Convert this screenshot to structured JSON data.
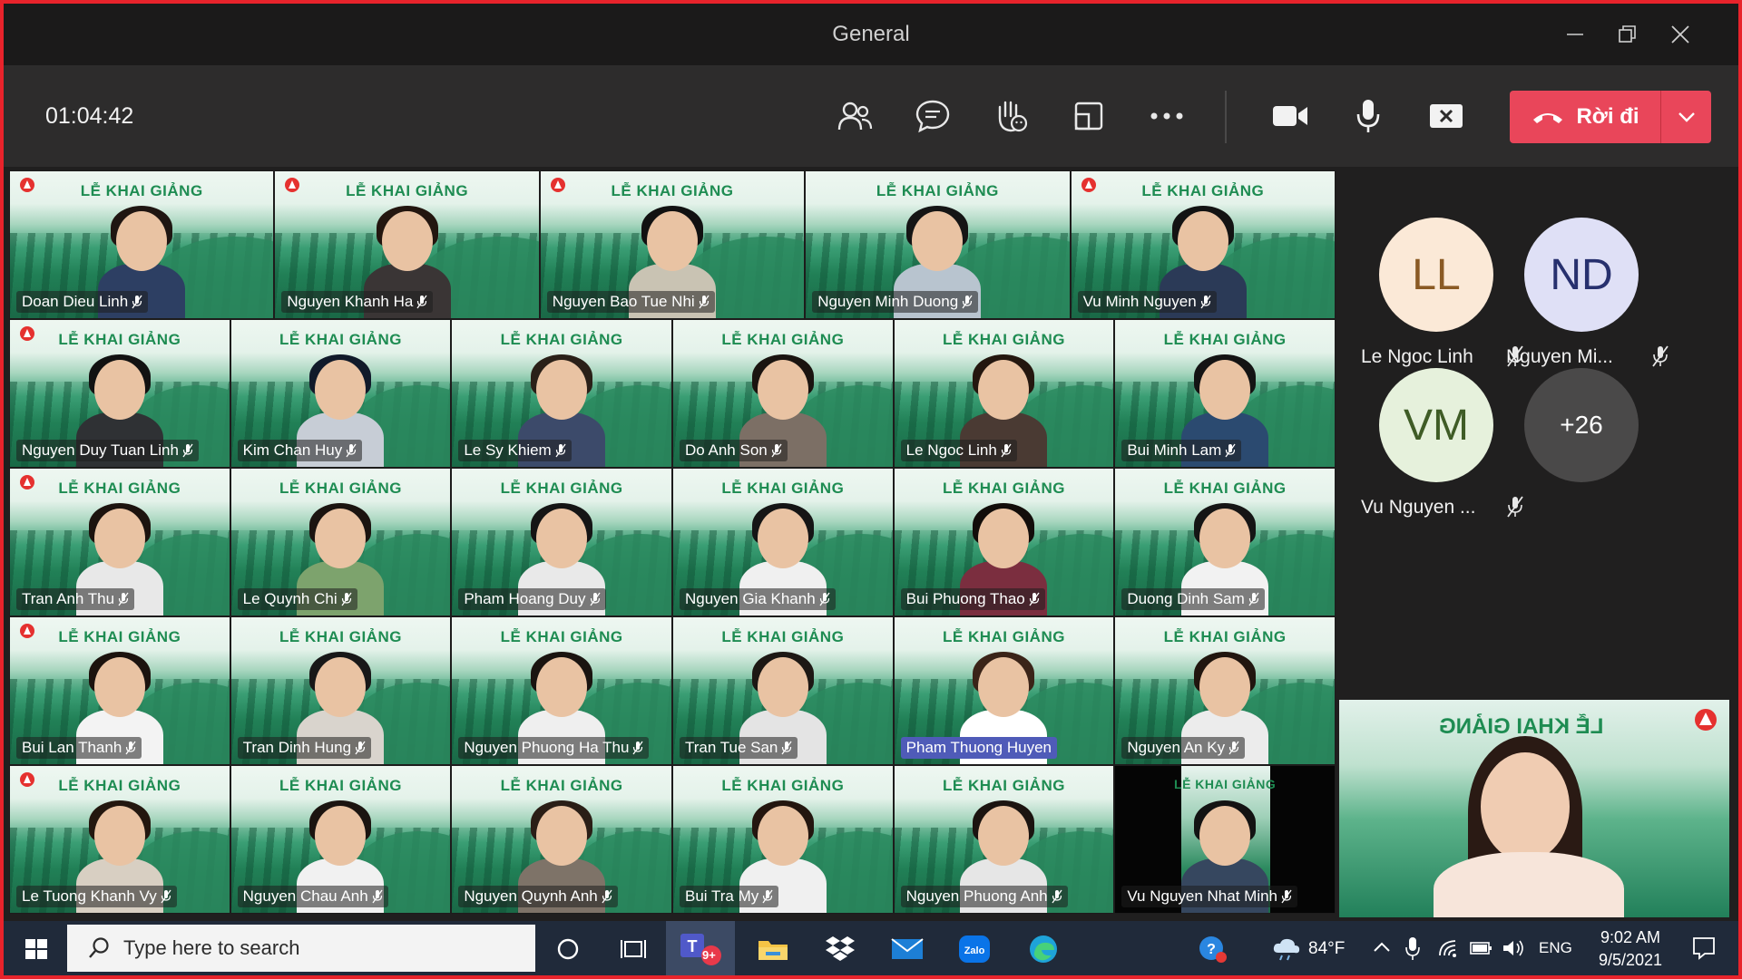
{
  "window": {
    "title": "General"
  },
  "toolbar": {
    "timer": "01:04:42",
    "leave_label": "Rời đi"
  },
  "grid": {
    "banner_text": "LỄ KHAI GIẢNG",
    "rows": [
      [
        {
          "name": "Doan Dieu Linh",
          "shirt": "#2d3f63",
          "hair": "#1f1612"
        },
        {
          "name": "Nguyen Khanh Ha",
          "shirt": "#3a3535",
          "hair": "#23160f"
        },
        {
          "name": "Nguyen Bao Tue Nhi",
          "shirt": "#c9c3b3",
          "hair": "#111111"
        },
        {
          "name": "Nguyen Minh Duong",
          "shirt": "#b8c4cf",
          "hair": "#151515"
        },
        {
          "name": "Vu Minh Nguyen",
          "shirt": "#2b3a57",
          "hair": "#131313"
        }
      ],
      [
        {
          "name": "Nguyen Duy Tuan Linh",
          "shirt": "#2f3134",
          "hair": "#121212"
        },
        {
          "name": "Kim Chan Huy",
          "shirt": "#c7cdd6",
          "hair": "#111a2a"
        },
        {
          "name": "Le Sy Khiem",
          "shirt": "#3c4a6a",
          "hair": "#2a2018"
        },
        {
          "name": "Do Anh Son",
          "shirt": "#7c6f65",
          "hair": "#1a1410"
        },
        {
          "name": "Le Ngoc Linh",
          "shirt": "#4a3a33",
          "hair": "#24170f"
        },
        {
          "name": "Bui Minh Lam",
          "shirt": "#2b4a70",
          "hair": "#141414"
        }
      ],
      [
        {
          "name": "Tran Anh Thu",
          "shirt": "#e8e8e8",
          "hair": "#1c130e"
        },
        {
          "name": "Le Quynh Chi",
          "shirt": "#7da36d",
          "hair": "#1b1410"
        },
        {
          "name": "Pham Hoang Duy",
          "shirt": "#e9e9e9",
          "hair": "#151515"
        },
        {
          "name": "Nguyen Gia Khanh",
          "shirt": "#f0f0f0",
          "hair": "#151515"
        },
        {
          "name": "Bui Phuong Thao",
          "shirt": "#7b2e3f",
          "hair": "#120d0a"
        },
        {
          "name": "Duong Dinh Sam",
          "shirt": "#f2f2f2",
          "hair": "#151515"
        }
      ],
      [
        {
          "name": "Bui Lan Thanh",
          "shirt": "#f3f3f3",
          "hair": "#1c130e"
        },
        {
          "name": "Tran Dinh Hung",
          "shirt": "#d9d4cd",
          "hair": "#181818"
        },
        {
          "name": "Nguyen Phuong Ha Thu",
          "shirt": "#efefef",
          "hair": "#1a1410"
        },
        {
          "name": "Tran Tue San",
          "shirt": "#e4e4e4",
          "hair": "#1d1814"
        },
        {
          "name": "Pham Thuong Huyen",
          "shirt": "#ffffff",
          "hair": "#3a2418",
          "highlight": true
        },
        {
          "name": "Nguyen An Ky",
          "shirt": "#ececec",
          "hair": "#21160f"
        }
      ],
      [
        {
          "name": "Le Tuong Khanh Vy",
          "shirt": "#d8cfc2",
          "hair": "#23170f"
        },
        {
          "name": "Nguyen Chau Anh",
          "shirt": "#f1f1f1",
          "hair": "#1b1410"
        },
        {
          "name": "Nguyen Quynh Anh",
          "shirt": "#7e7368",
          "hair": "#2a1e16"
        },
        {
          "name": "Bui Tra My",
          "shirt": "#f0f0f0",
          "hair": "#23160f"
        },
        {
          "name": "Nguyen Phuong Anh",
          "shirt": "#e6e6e6",
          "hair": "#1b1410"
        },
        {
          "name": "Vu Nguyen Nhat Minh",
          "shirt": "#36475f",
          "hair": "#131313",
          "dark": true
        }
      ]
    ]
  },
  "roster": [
    {
      "initials": "LL",
      "name": "Le Ngoc Linh",
      "bg": "#fbe9d7",
      "fg": "#8a5a24"
    },
    {
      "initials": "ND",
      "name": "Nguyen Mi...",
      "bg": "#dfe0f6",
      "fg": "#27306e"
    },
    {
      "initials": "VM",
      "name": "Vu Nguyen ...",
      "bg": "#e6f1dc",
      "fg": "#3f5c26"
    },
    {
      "initials": "+26",
      "name": "",
      "bg": "#4a4949",
      "fg": "#ffffff"
    }
  ],
  "presenter": {
    "banner": "LỄ KHAI GIẢNG"
  },
  "taskbar": {
    "search_placeholder": "Type here to search",
    "teams_badge": "9+",
    "temperature": "84°F",
    "language": "ENG",
    "time": "9:02 AM",
    "date": "9/5/2021"
  }
}
